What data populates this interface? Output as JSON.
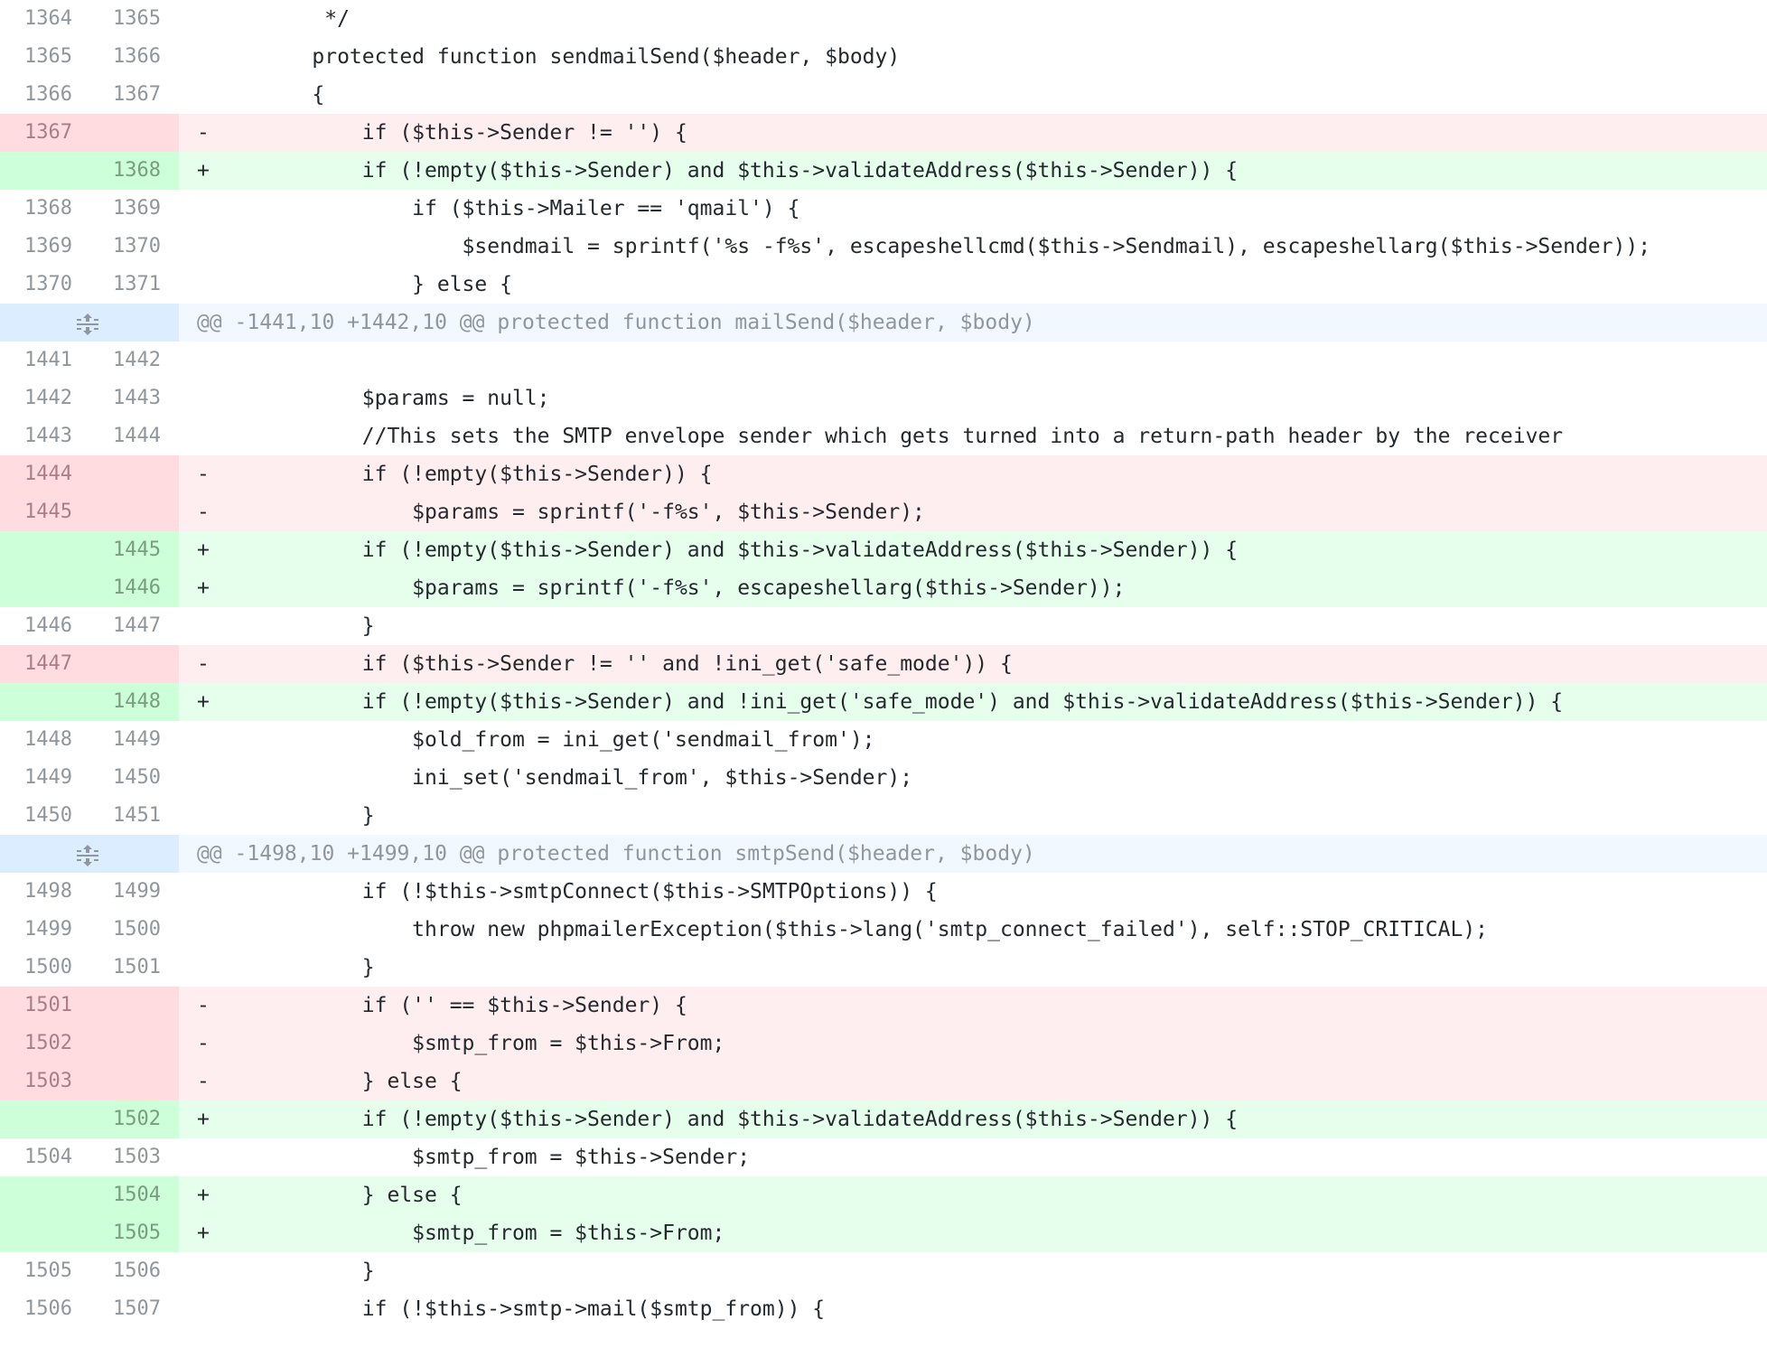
{
  "diff": {
    "hunks": [
      {
        "header": "",
        "lines": [
          {
            "type": "ctx",
            "old": "1364",
            "new": "1365",
            "marker": "",
            "code": "     */"
          },
          {
            "type": "ctx",
            "old": "1365",
            "new": "1366",
            "marker": "",
            "code": "    protected function sendmailSend($header, $body)"
          },
          {
            "type": "ctx",
            "old": "1366",
            "new": "1367",
            "marker": "",
            "code": "    {"
          },
          {
            "type": "del",
            "old": "1367",
            "new": "",
            "marker": "-",
            "code": "        if ($this->Sender != '') {"
          },
          {
            "type": "add",
            "old": "",
            "new": "1368",
            "marker": "+",
            "code": "        if (!empty($this->Sender) and $this->validateAddress($this->Sender)) {"
          },
          {
            "type": "ctx",
            "old": "1368",
            "new": "1369",
            "marker": "",
            "code": "            if ($this->Mailer == 'qmail') {"
          },
          {
            "type": "ctx",
            "old": "1369",
            "new": "1370",
            "marker": "",
            "code": "                $sendmail = sprintf('%s -f%s', escapeshellcmd($this->Sendmail), escapeshellarg($this->Sender));"
          },
          {
            "type": "ctx",
            "old": "1370",
            "new": "1371",
            "marker": "",
            "code": "            } else {"
          }
        ]
      },
      {
        "header": "@@ -1441,10 +1442,10 @@ protected function mailSend($header, $body)",
        "lines": [
          {
            "type": "ctx",
            "old": "1441",
            "new": "1442",
            "marker": "",
            "code": ""
          },
          {
            "type": "ctx",
            "old": "1442",
            "new": "1443",
            "marker": "",
            "code": "        $params = null;"
          },
          {
            "type": "ctx",
            "old": "1443",
            "new": "1444",
            "marker": "",
            "code": "        //This sets the SMTP envelope sender which gets turned into a return-path header by the receiver"
          },
          {
            "type": "del",
            "old": "1444",
            "new": "",
            "marker": "-",
            "code": "        if (!empty($this->Sender)) {"
          },
          {
            "type": "del",
            "old": "1445",
            "new": "",
            "marker": "-",
            "code": "            $params = sprintf('-f%s', $this->Sender);"
          },
          {
            "type": "add",
            "old": "",
            "new": "1445",
            "marker": "+",
            "code": "        if (!empty($this->Sender) and $this->validateAddress($this->Sender)) {"
          },
          {
            "type": "add",
            "old": "",
            "new": "1446",
            "marker": "+",
            "code": "            $params = sprintf('-f%s', escapeshellarg($this->Sender));"
          },
          {
            "type": "ctx",
            "old": "1446",
            "new": "1447",
            "marker": "",
            "code": "        }"
          },
          {
            "type": "del",
            "old": "1447",
            "new": "",
            "marker": "-",
            "code": "        if ($this->Sender != '' and !ini_get('safe_mode')) {"
          },
          {
            "type": "add",
            "old": "",
            "new": "1448",
            "marker": "+",
            "code": "        if (!empty($this->Sender) and !ini_get('safe_mode') and $this->validateAddress($this->Sender)) {"
          },
          {
            "type": "ctx",
            "old": "1448",
            "new": "1449",
            "marker": "",
            "code": "            $old_from = ini_get('sendmail_from');"
          },
          {
            "type": "ctx",
            "old": "1449",
            "new": "1450",
            "marker": "",
            "code": "            ini_set('sendmail_from', $this->Sender);"
          },
          {
            "type": "ctx",
            "old": "1450",
            "new": "1451",
            "marker": "",
            "code": "        }"
          }
        ]
      },
      {
        "header": "@@ -1498,10 +1499,10 @@ protected function smtpSend($header, $body)",
        "lines": [
          {
            "type": "ctx",
            "old": "1498",
            "new": "1499",
            "marker": "",
            "code": "        if (!$this->smtpConnect($this->SMTPOptions)) {"
          },
          {
            "type": "ctx",
            "old": "1499",
            "new": "1500",
            "marker": "",
            "code": "            throw new phpmailerException($this->lang('smtp_connect_failed'), self::STOP_CRITICAL);"
          },
          {
            "type": "ctx",
            "old": "1500",
            "new": "1501",
            "marker": "",
            "code": "        }"
          },
          {
            "type": "del",
            "old": "1501",
            "new": "",
            "marker": "-",
            "code": "        if ('' == $this->Sender) {"
          },
          {
            "type": "del",
            "old": "1502",
            "new": "",
            "marker": "-",
            "code": "            $smtp_from = $this->From;"
          },
          {
            "type": "del",
            "old": "1503",
            "new": "",
            "marker": "-",
            "code": "        } else {"
          },
          {
            "type": "add",
            "old": "",
            "new": "1502",
            "marker": "+",
            "code": "        if (!empty($this->Sender) and $this->validateAddress($this->Sender)) {"
          },
          {
            "type": "ctx",
            "old": "1504",
            "new": "1503",
            "marker": "",
            "code": "            $smtp_from = $this->Sender;"
          },
          {
            "type": "add",
            "old": "",
            "new": "1504",
            "marker": "+",
            "code": "        } else {"
          },
          {
            "type": "add",
            "old": "",
            "new": "1505",
            "marker": "+",
            "code": "            $smtp_from = $this->From;"
          },
          {
            "type": "ctx",
            "old": "1505",
            "new": "1506",
            "marker": "",
            "code": "        }"
          },
          {
            "type": "ctx",
            "old": "1506",
            "new": "1507",
            "marker": "",
            "code": "        if (!$this->smtp->mail($smtp_from)) {"
          }
        ]
      }
    ]
  },
  "icons": {
    "expand": "unfold-icon"
  },
  "colors": {
    "added_bg": "#e6ffed",
    "added_gutter": "#cdffd8",
    "added_highlight": "#acf2bd",
    "removed_bg": "#ffeef0",
    "removed_gutter": "#ffdce0",
    "removed_highlight": "#fdb8c0",
    "hunk_bg": "#f1f8ff",
    "hunk_gutter": "#dbedff"
  }
}
